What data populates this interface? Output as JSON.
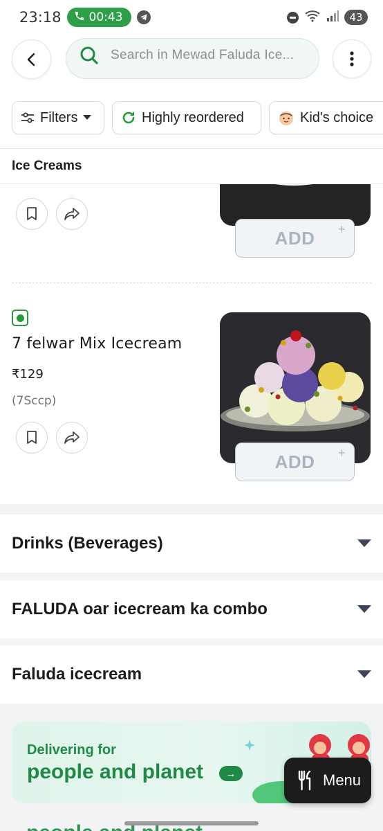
{
  "status_bar": {
    "time": "23:18",
    "call_timer": "00:43",
    "battery": "43"
  },
  "header": {
    "search_placeholder": "Search in Mewad Faluda Ice..."
  },
  "filters": [
    {
      "label": "Filters"
    },
    {
      "label": "Highly reordered"
    },
    {
      "label": "Kid's choice"
    }
  ],
  "section": {
    "title": "Ice Creams"
  },
  "previous_item": {
    "add_label": "ADD",
    "add_plus": "+"
  },
  "item": {
    "name": "7 felwar Mix Icecream",
    "price": "₹129",
    "description": "(7Sccp)",
    "add_label": "ADD",
    "add_plus": "+"
  },
  "categories": [
    {
      "name": "Drinks (Beverages)"
    },
    {
      "name": "FALUDA oar icecream ka combo"
    },
    {
      "name": "Faluda icecream"
    }
  ],
  "banner": {
    "line1": "Delivering for",
    "line2": "people and planet",
    "arrow": "→"
  },
  "menu_button": {
    "label": "Menu"
  },
  "colors": {
    "brand_green": "#1f8a45",
    "call_green": "#2e9e48",
    "veg_green": "#2a9a3d",
    "add_button_text": "#a9b4c1"
  }
}
